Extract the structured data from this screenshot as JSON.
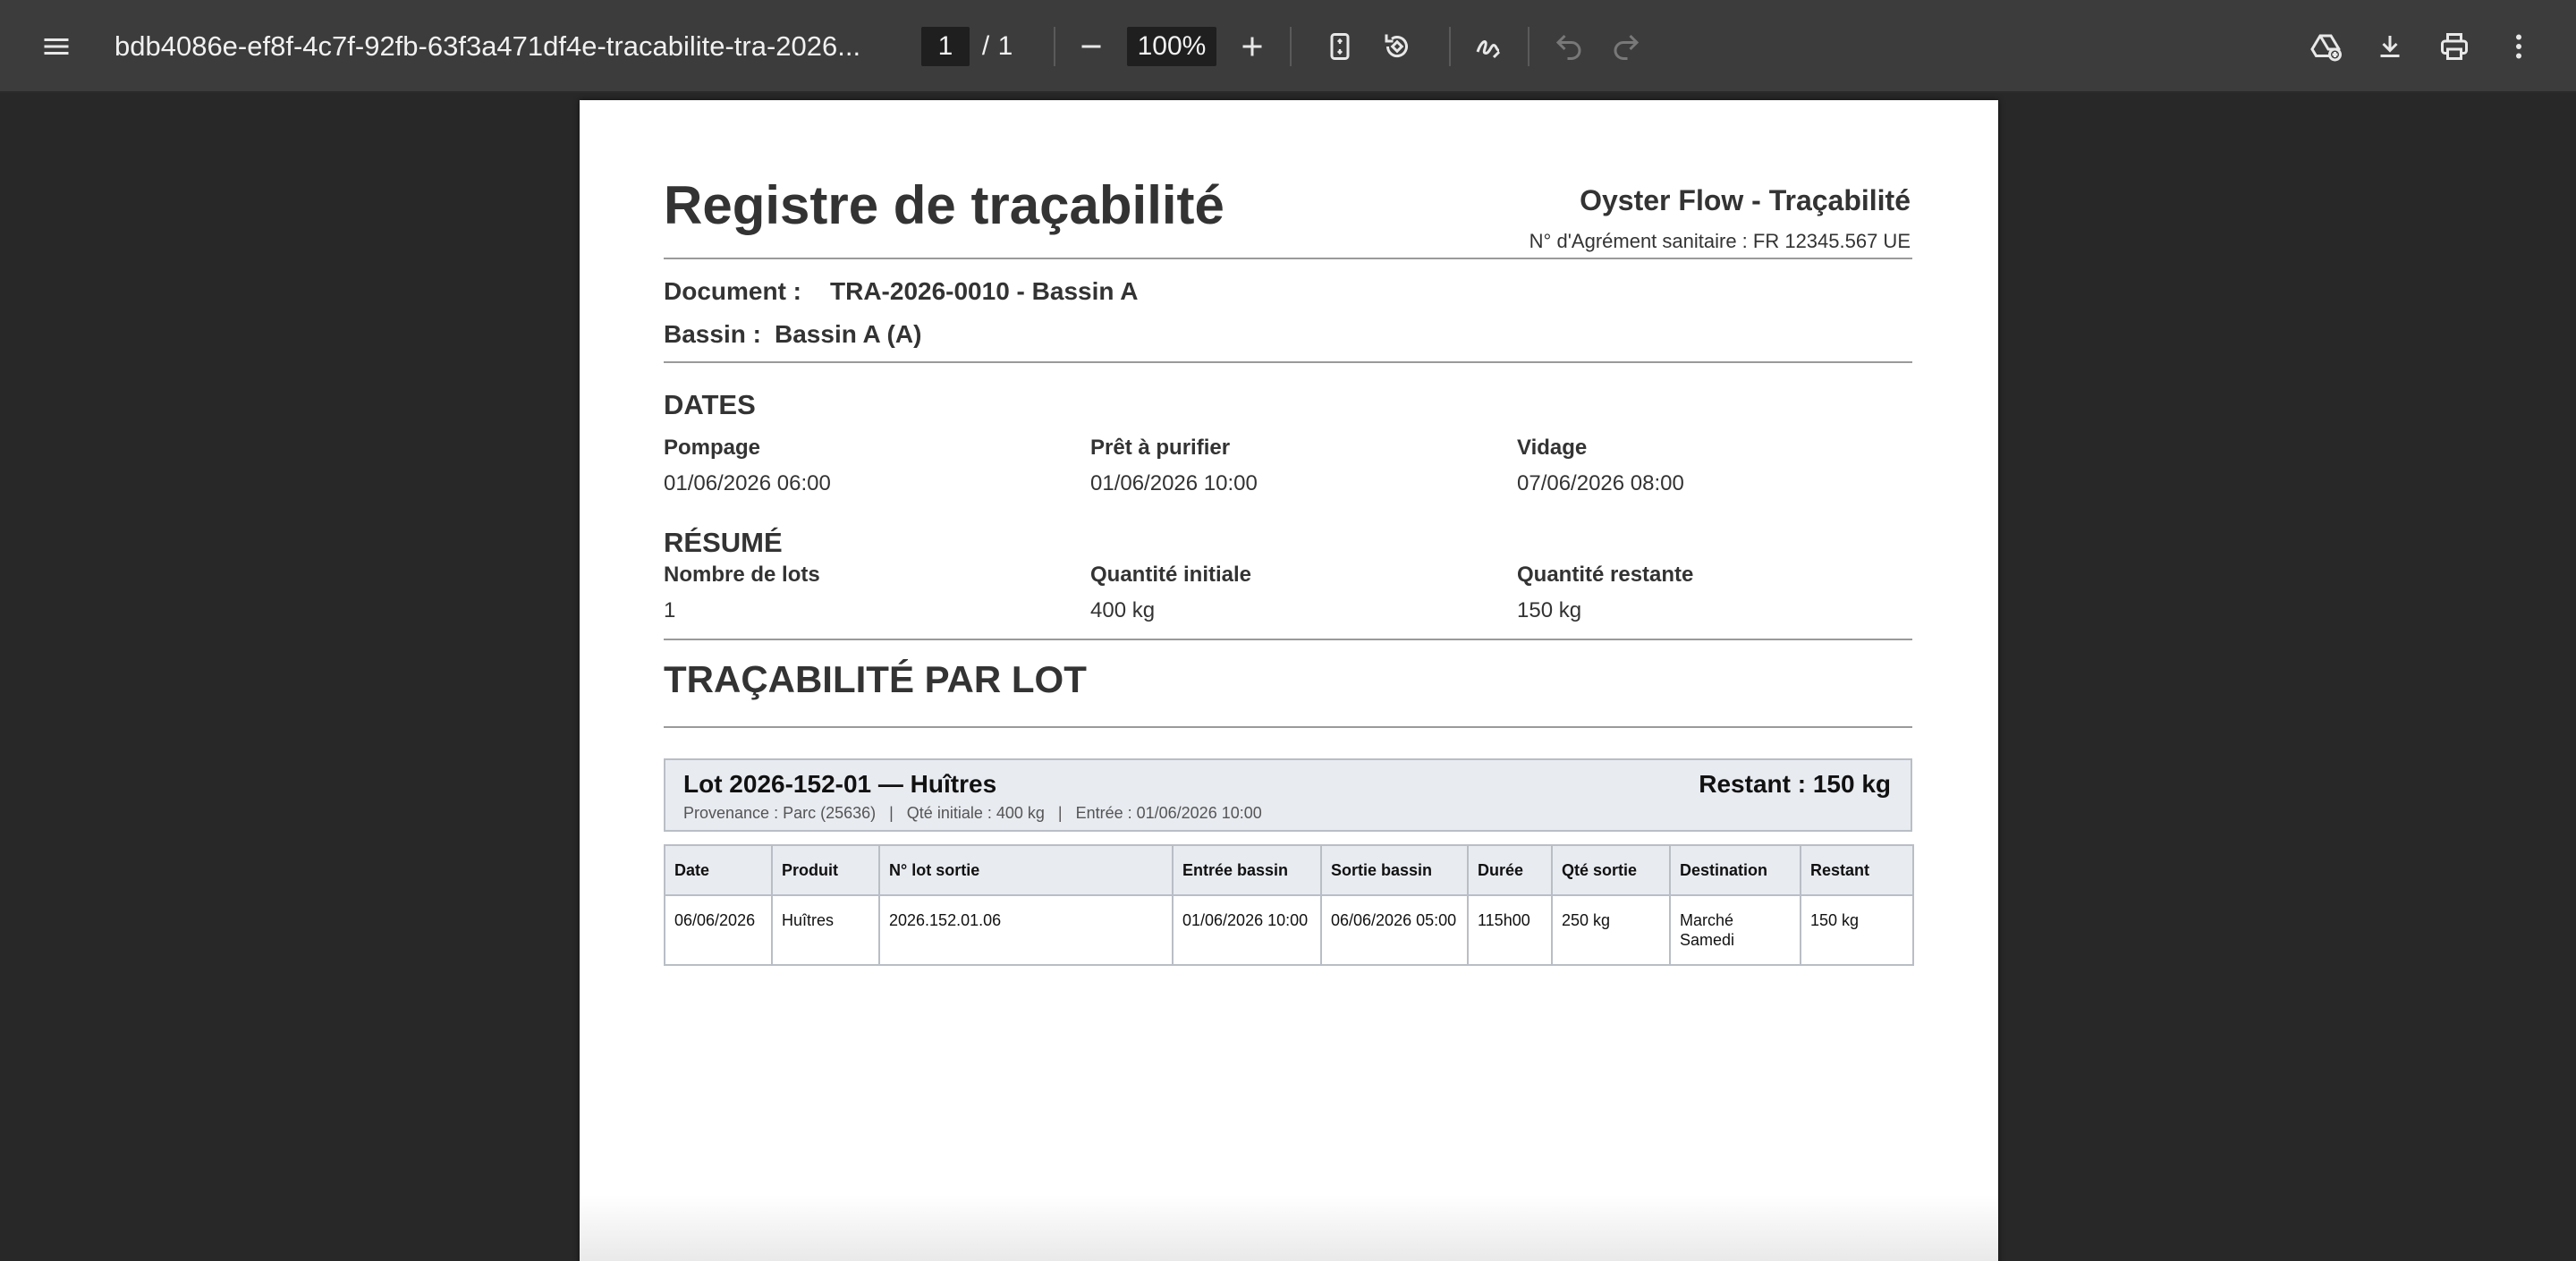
{
  "toolbar": {
    "title": "bdb4086e-ef8f-4c7f-92fb-63f3a471df4e-tracabilite-tra-2026...",
    "page_current": "1",
    "page_separator": "/",
    "page_total": "1",
    "zoom": "100%",
    "icons": [
      "menu-icon",
      "zoom-out-icon",
      "zoom-in-icon",
      "fit-page-icon",
      "rotate-icon",
      "annotate-icon",
      "undo-icon",
      "redo-icon",
      "save-to-drive-icon",
      "download-icon",
      "print-icon",
      "more-options-icon"
    ]
  },
  "document": {
    "title": "Registre de traçabilité",
    "brand": "Oyster Flow - Traçabilité",
    "agrement": "N° d'Agrément sanitaire : FR 12345.567 UE",
    "doc_label": "Document :",
    "doc_value": "TRA-2026-0010 - Bassin A",
    "bassin_label": "Bassin :",
    "bassin_value": "Bassin A (A)",
    "dates": {
      "title": "DATES",
      "pompage_label": "Pompage",
      "pompage_value": "01/06/2026 06:00",
      "pret_label": "Prêt à purifier",
      "pret_value": "01/06/2026 10:00",
      "vidage_label": "Vidage",
      "vidage_value": "07/06/2026 08:00"
    },
    "resume": {
      "title": "RÉSUMÉ",
      "lots_label": "Nombre de lots",
      "lots_value": "1",
      "qte_init_label": "Quantité initiale",
      "qte_init_value": "400 kg",
      "qte_rest_label": "Quantité restante",
      "qte_rest_value": "150 kg"
    },
    "traca_title": "TRAÇABILITÉ PAR LOT",
    "lot": {
      "title": "Lot 2026-152-01 — Huîtres",
      "remaining": "Restant : 150 kg",
      "subtitle": "Provenance : Parc (25636)   |   Qté initiale : 400 kg   |   Entrée : 01/06/2026 10:00"
    },
    "table": {
      "headers": [
        "Date",
        "Produit",
        "N° lot sortie",
        "Entrée bassin",
        "Sortie bassin",
        "Durée",
        "Qté sortie",
        "Destination",
        "Restant"
      ],
      "rows": [
        [
          "06/06/2026",
          "Huîtres",
          "2026.152.01.06",
          "01/06/2026 10:00",
          "06/06/2026 05:00",
          "115h00",
          "250 kg",
          "Marché Samedi",
          "150 kg"
        ]
      ]
    }
  }
}
